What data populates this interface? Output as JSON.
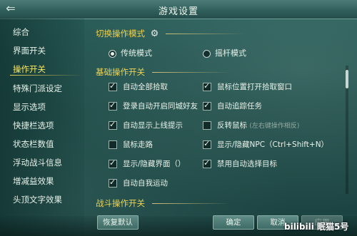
{
  "window": {
    "title": "游戏设置",
    "close_symbol": "⇐"
  },
  "sidebar": {
    "items": [
      {
        "label": "综合"
      },
      {
        "label": "界面开关"
      },
      {
        "label": "操作开关"
      },
      {
        "label": "特殊门派设定"
      },
      {
        "label": "显示选项"
      },
      {
        "label": "快捷栏选项"
      },
      {
        "label": "状态栏数值"
      },
      {
        "label": "浮动战斗信息"
      },
      {
        "label": "增减益效果"
      },
      {
        "label": "头顶文字效果"
      }
    ],
    "active_index": 2
  },
  "sections": {
    "switch_mode": {
      "title": "切换操作模式"
    },
    "basic": {
      "title": "基础操作开关"
    },
    "combat": {
      "title": "战斗操作开关"
    }
  },
  "mode": {
    "options": [
      {
        "label": "传统模式",
        "selected": true
      },
      {
        "label": "摇杆模式",
        "selected": false
      }
    ]
  },
  "basic_options": [
    {
      "label": "自动全部拾取",
      "checked": true
    },
    {
      "label": "鼠标位置打开拾取窗口",
      "checked": true
    },
    {
      "label": "登录自动开启同城好友",
      "checked": true
    },
    {
      "label": "自动追踪任务",
      "checked": true
    },
    {
      "label": "自动显示上线提示",
      "checked": true
    },
    {
      "label": "反转鼠标",
      "note": "(左右键操作相反)",
      "checked": false
    },
    {
      "label": "鼠标走路",
      "checked": false
    },
    {
      "label": "显示/隐藏NPC（Ctrl+Shift+N）",
      "checked": true
    },
    {
      "label": "显示/隐藏界面（）",
      "checked": true
    },
    {
      "label": "禁用自动选择目标",
      "checked": true
    },
    {
      "label": "自动自我运动",
      "checked": true
    }
  ],
  "footer": {
    "restore_label": "恢复默认",
    "ok_label": "确定",
    "cancel_label": "取消",
    "apply_label": "应用"
  },
  "watermark": "bilibili 眠猫5号"
}
